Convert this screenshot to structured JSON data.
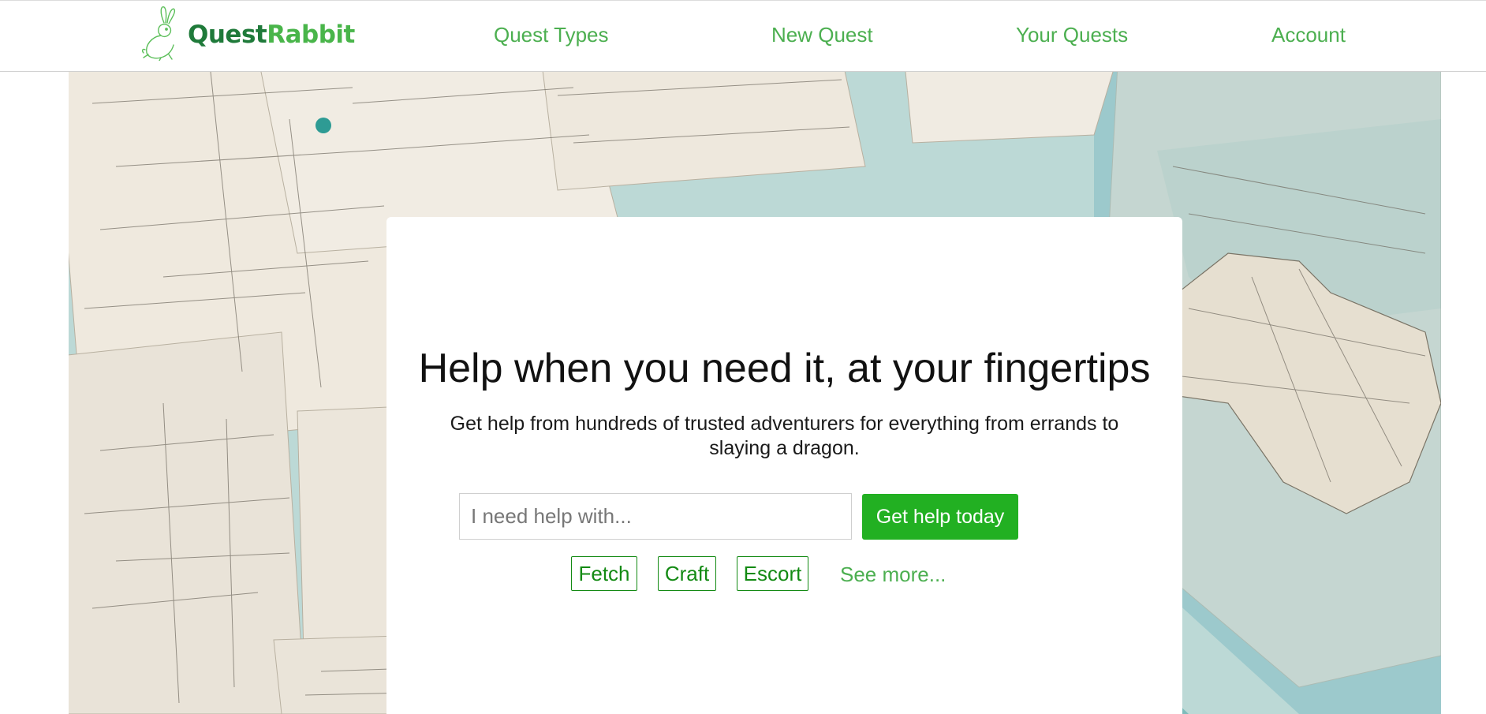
{
  "brand": {
    "name_part1": "Quest",
    "name_part2": "Rabbit",
    "logo_icon": "rabbit-outline-icon",
    "colors": {
      "dark": "#1f7a3a",
      "light": "#49b54a"
    }
  },
  "nav": {
    "items": [
      {
        "label": "Quest Types"
      },
      {
        "label": "New Quest"
      },
      {
        "label": "Your Quests"
      },
      {
        "label": "Account"
      }
    ]
  },
  "hero": {
    "background": "vintage-maps-photo",
    "headline": "Help when you need it, at your fingertips",
    "subtext": "Get help from hundreds of trusted adventurers for everything from errands to slaying a dragon.",
    "search": {
      "placeholder": "I need help with...",
      "value": "",
      "button_label": "Get help today"
    },
    "categories": [
      {
        "label": "Fetch"
      },
      {
        "label": "Craft"
      },
      {
        "label": "Escort"
      }
    ],
    "see_more_label": "See more..."
  },
  "colors": {
    "accent": "#4caf50",
    "button": "#22b022",
    "chip": "#138a13"
  }
}
